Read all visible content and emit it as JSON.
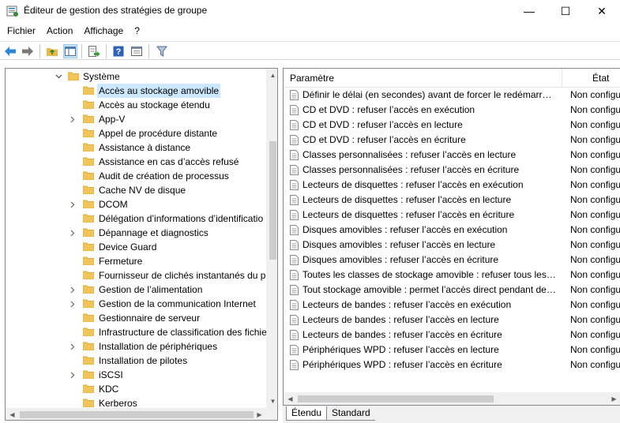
{
  "window": {
    "title": "Éditeur de gestion des stratégies de groupe",
    "icon": "gpo-editor-icon",
    "controls": {
      "minimize": "—",
      "maximize": "☐",
      "close": "✕"
    }
  },
  "menu": [
    "Fichier",
    "Action",
    "Affichage",
    "?"
  ],
  "toolbar": {
    "icons": [
      "back-icon",
      "forward-icon",
      "up-folder-icon",
      "show-hide-tree-icon",
      "export-list-icon",
      "help-icon",
      "properties-icon",
      "filter-icon"
    ]
  },
  "tree": {
    "root": "Système",
    "items": [
      {
        "label": "Accès au stockage amovible",
        "expandable": false,
        "selected": true
      },
      {
        "label": "Accès au stockage étendu",
        "expandable": false
      },
      {
        "label": "App-V",
        "expandable": true
      },
      {
        "label": "Appel de procédure distante",
        "expandable": false
      },
      {
        "label": "Assistance à distance",
        "expandable": false
      },
      {
        "label": "Assistance en cas d’accès refusé",
        "expandable": false
      },
      {
        "label": "Audit de création de processus",
        "expandable": false
      },
      {
        "label": "Cache NV de disque",
        "expandable": false
      },
      {
        "label": "DCOM",
        "expandable": true
      },
      {
        "label": "Délégation d’informations d’identificatio",
        "expandable": false
      },
      {
        "label": "Dépannage et diagnostics",
        "expandable": true
      },
      {
        "label": "Device Guard",
        "expandable": false
      },
      {
        "label": "Fermeture",
        "expandable": false
      },
      {
        "label": "Fournisseur de clichés instantanés du pa",
        "expandable": false
      },
      {
        "label": "Gestion de l’alimentation",
        "expandable": true
      },
      {
        "label": "Gestion de la communication Internet",
        "expandable": true
      },
      {
        "label": "Gestionnaire de serveur",
        "expandable": false
      },
      {
        "label": "Infrastructure de classification des fichie",
        "expandable": false
      },
      {
        "label": "Installation de périphériques",
        "expandable": true
      },
      {
        "label": "Installation de pilotes",
        "expandable": false
      },
      {
        "label": "iSCSI",
        "expandable": true
      },
      {
        "label": "KDC",
        "expandable": false
      },
      {
        "label": "Kerberos",
        "expandable": false
      }
    ]
  },
  "list": {
    "columns": {
      "param": "Paramètre",
      "etat": "État"
    },
    "rows": [
      {
        "param": "Définir le délai (en secondes) avant de forcer le redémarrage",
        "etat": "Non configuré"
      },
      {
        "param": "CD et DVD : refuser l’accès en exécution",
        "etat": "Non configuré"
      },
      {
        "param": "CD et DVD : refuser l’accès en lecture",
        "etat": "Non configuré"
      },
      {
        "param": "CD et DVD : refuser l’accès en écriture",
        "etat": "Non configuré"
      },
      {
        "param": "Classes personnalisées : refuser l’accès en lecture",
        "etat": "Non configuré"
      },
      {
        "param": "Classes personnalisées : refuser l’accès en écriture",
        "etat": "Non configuré"
      },
      {
        "param": "Lecteurs de disquettes : refuser l’accès en exécution",
        "etat": "Non configuré"
      },
      {
        "param": "Lecteurs de disquettes : refuser l’accès en lecture",
        "etat": "Non configuré"
      },
      {
        "param": "Lecteurs de disquettes : refuser l’accès en écriture",
        "etat": "Non configuré"
      },
      {
        "param": "Disques amovibles : refuser l’accès en exécution",
        "etat": "Non configuré"
      },
      {
        "param": "Disques amovibles : refuser l’accès en lecture",
        "etat": "Non configuré"
      },
      {
        "param": "Disques amovibles : refuser l’accès en écriture",
        "etat": "Non configuré"
      },
      {
        "param": "Toutes les classes de stockage amovible : refuser tous les ac...",
        "etat": "Non configuré"
      },
      {
        "param": "Tout stockage amovible : permet l’accès direct pendant des ...",
        "etat": "Non configuré"
      },
      {
        "param": "Lecteurs de bandes : refuser l’accès en exécution",
        "etat": "Non configuré"
      },
      {
        "param": "Lecteurs de bandes : refuser l’accès en lecture",
        "etat": "Non configuré"
      },
      {
        "param": "Lecteurs de bandes : refuser l’accès en écriture",
        "etat": "Non configuré"
      },
      {
        "param": "Périphériques WPD : refuser l’accès en lecture",
        "etat": "Non configuré"
      },
      {
        "param": "Périphériques WPD : refuser l’accès en écriture",
        "etat": "Non configuré"
      }
    ]
  },
  "tabs": [
    "Étendu",
    "Standard"
  ],
  "colors": {
    "folder": "#f2c55c",
    "folder_dark": "#dcab3c",
    "selection": "#cce8ff",
    "accent": "#1e73c8"
  }
}
